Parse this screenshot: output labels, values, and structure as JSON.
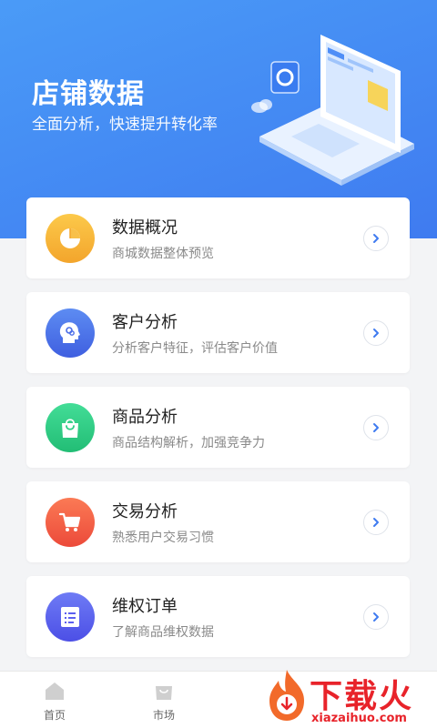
{
  "header": {
    "title": "店铺数据",
    "subtitle": "全面分析，快速提升转化率"
  },
  "cards": [
    {
      "title": "数据概况",
      "desc": "商城数据整体预览",
      "icon": "pie-chart-icon",
      "color": "#f7b53a"
    },
    {
      "title": "客户分析",
      "desc": "分析客户特征，评估客户价值",
      "icon": "head-profile-icon",
      "color": "#4a6de8"
    },
    {
      "title": "商品分析",
      "desc": "商品结构解析，加强竞争力",
      "icon": "shopping-bag-icon",
      "color": "#2fcf85"
    },
    {
      "title": "交易分析",
      "desc": "熟悉用户交易习惯",
      "icon": "shopping-cart-icon",
      "color": "#f25e48"
    },
    {
      "title": "维权订单",
      "desc": "了解商品维权数据",
      "icon": "document-icon",
      "color": "#5b5ff0"
    }
  ],
  "tabbar": {
    "items": [
      {
        "label": "首页",
        "icon": "home-icon"
      },
      {
        "label": "市场",
        "icon": "bag-icon"
      }
    ]
  },
  "watermark": {
    "text": "下载火",
    "url": "xiazaihuo.com"
  }
}
